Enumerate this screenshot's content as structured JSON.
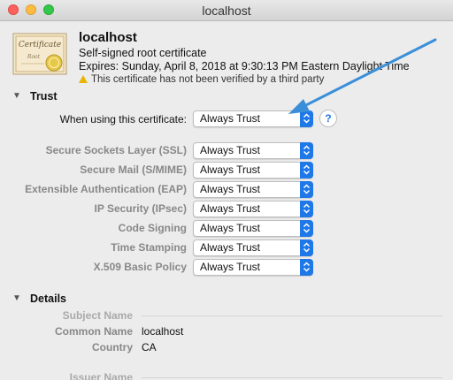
{
  "window": {
    "title": "localhost"
  },
  "certificate": {
    "icon_text_top": "Certificate",
    "icon_text_sub": "Root",
    "name": "localhost",
    "type": "Self-signed root certificate",
    "expires": "Expires: Sunday, April 8, 2018 at 9:30:13 PM Eastern Daylight Time",
    "warning": "This certificate has not been verified by a third party"
  },
  "trust": {
    "section_title": "Trust",
    "disclosure": "▼",
    "when_using_label": "When using this certificate:",
    "when_using_value": "Always Trust",
    "help_label": "?",
    "rows": [
      {
        "label": "Secure Sockets Layer (SSL)",
        "value": "Always Trust"
      },
      {
        "label": "Secure Mail (S/MIME)",
        "value": "Always Trust"
      },
      {
        "label": "Extensible Authentication (EAP)",
        "value": "Always Trust"
      },
      {
        "label": "IP Security (IPsec)",
        "value": "Always Trust"
      },
      {
        "label": "Code Signing",
        "value": "Always Trust"
      },
      {
        "label": "Time Stamping",
        "value": "Always Trust"
      },
      {
        "label": "X.509 Basic Policy",
        "value": "Always Trust"
      }
    ]
  },
  "details": {
    "section_title": "Details",
    "disclosure": "▼",
    "subject_heading": "Subject Name",
    "common_name_label": "Common Name",
    "common_name_value": "localhost",
    "country_label": "Country",
    "country_value": "CA",
    "issuer_heading": "Issuer Name"
  },
  "colors": {
    "accent": "#1e78e7",
    "annotation_arrow": "#3b8fd9"
  }
}
